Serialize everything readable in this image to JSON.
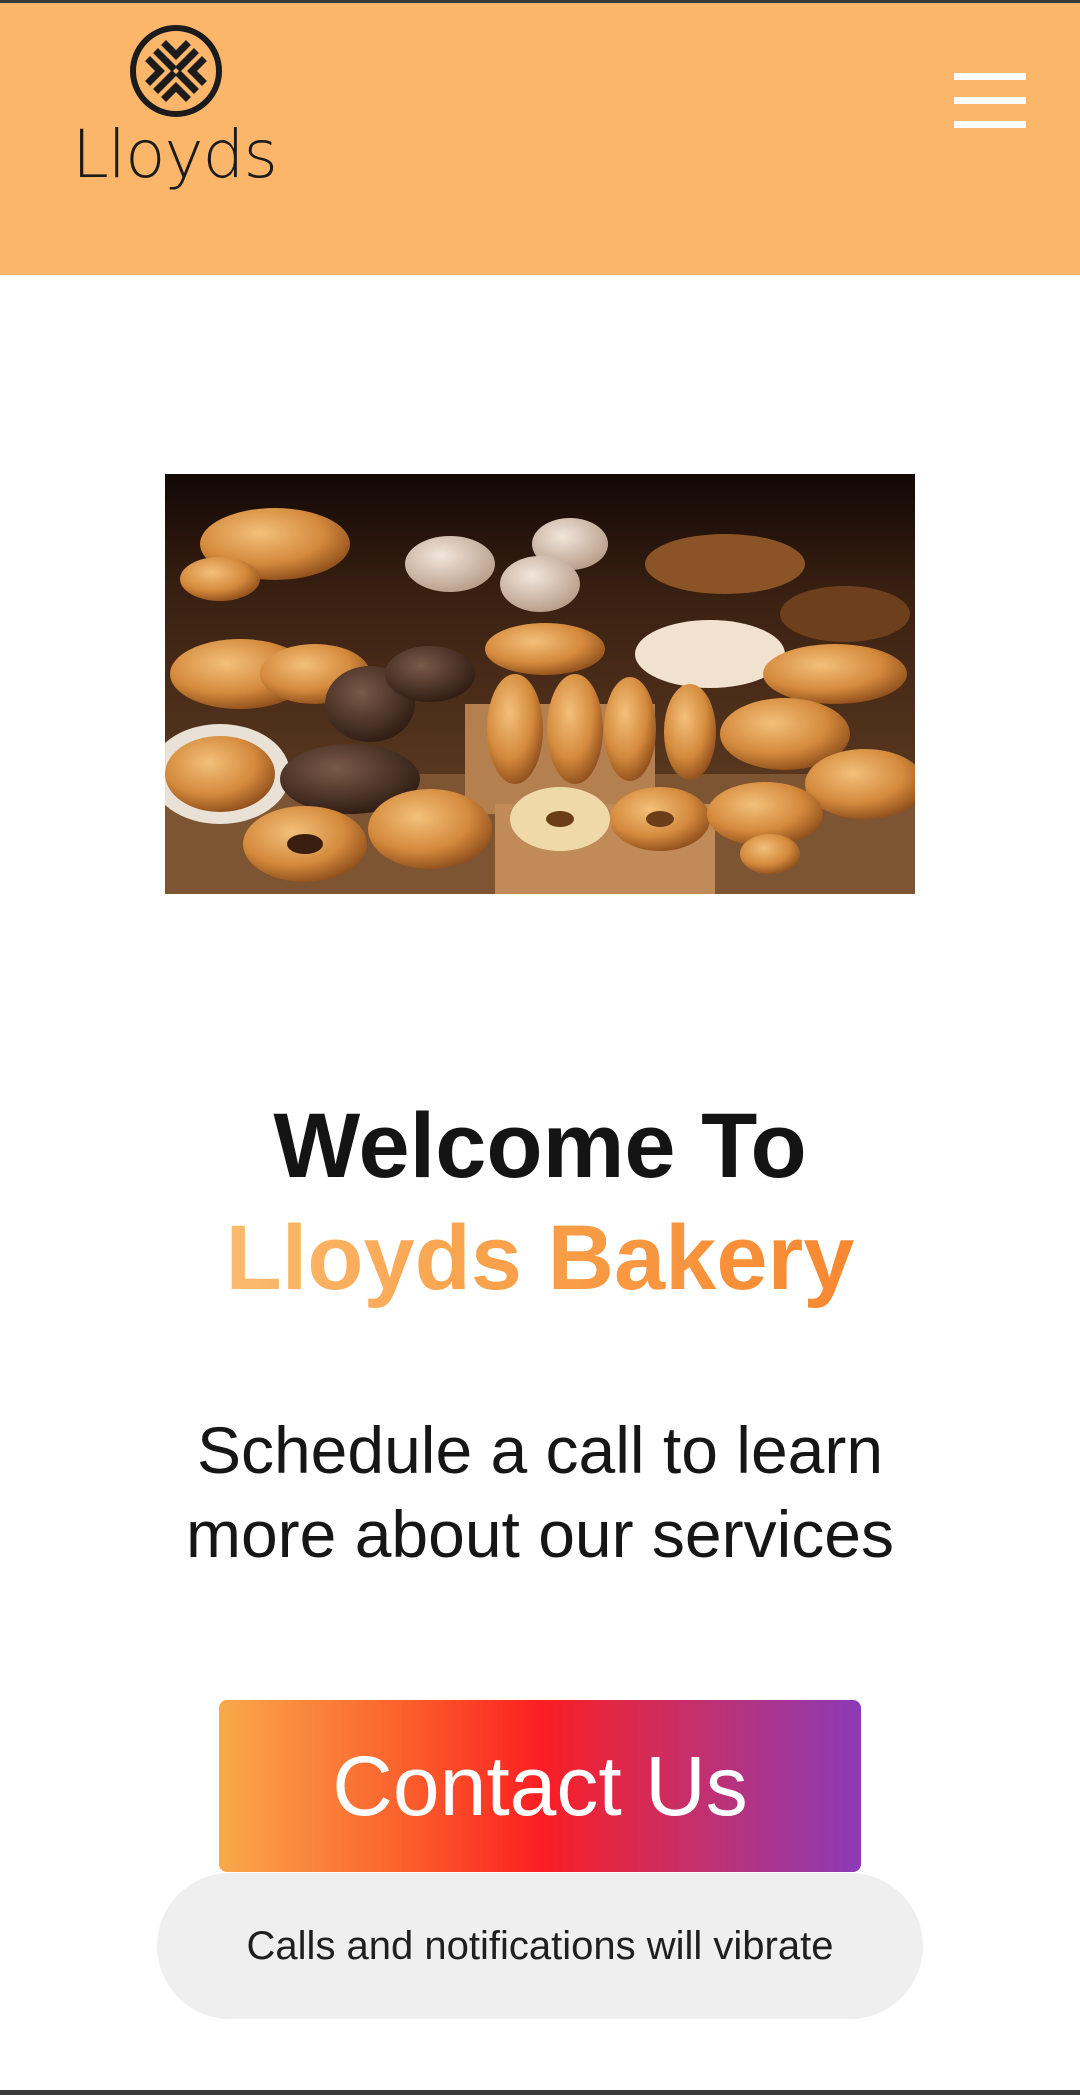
{
  "header": {
    "brand": "Lloyds",
    "menu_icon": "hamburger-menu-icon",
    "background_color": "#fbb66a"
  },
  "hero": {
    "image_subject": "bakery-pastries-image"
  },
  "headline": {
    "line1": "Welcome To",
    "line2": "Lloyds Bakery"
  },
  "subtitle": "Schedule a call to learn more about our services",
  "cta": {
    "label": "Contact Us"
  },
  "toast": {
    "message": "Calls and notifications will vibrate"
  },
  "colors": {
    "accent_orange": "#f5781e",
    "accent_light": "#fcd08c",
    "cta_gradient_start": "#f9a94a",
    "cta_gradient_mid": "#fb1f23",
    "cta_gradient_end": "#8b3bb8"
  }
}
